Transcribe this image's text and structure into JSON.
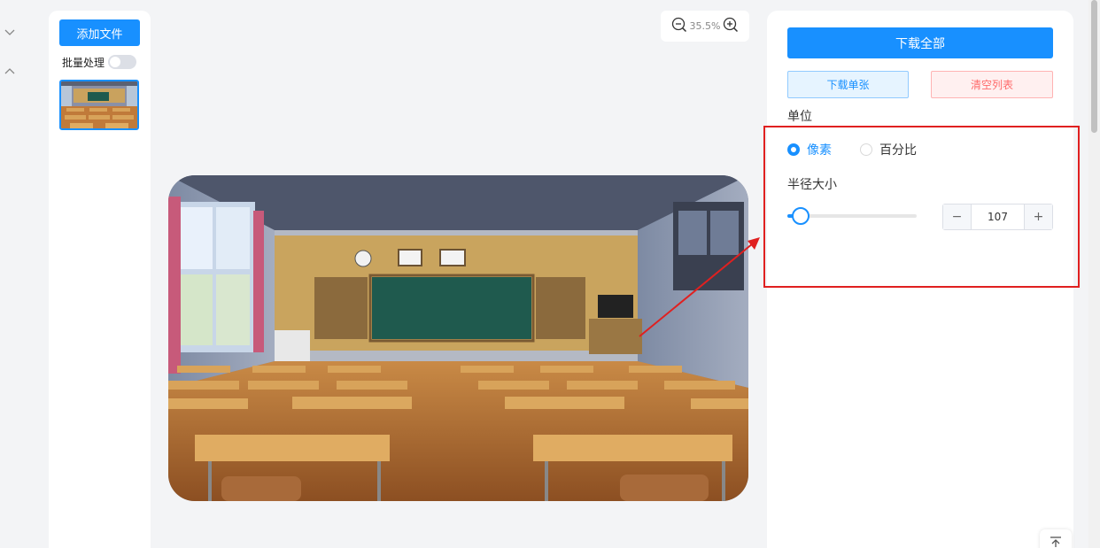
{
  "left": {
    "add_file_label": "添加文件",
    "batch_label": "批量处理",
    "batch_enabled": false
  },
  "zoom": {
    "level": "35.5%"
  },
  "right": {
    "download_all_label": "下载全部",
    "download_single_label": "下载单张",
    "clear_list_label": "清空列表",
    "unit_label": "单位",
    "unit_options": [
      "像素",
      "百分比"
    ],
    "unit_selected": "像素",
    "radius_label": "半径大小",
    "radius_value": "107",
    "slider_fraction": 0.1
  },
  "colors": {
    "primary": "#1890ff",
    "danger": "#ff6b6b",
    "highlight": "#e02020"
  },
  "icons": [
    "chevron-down-icon",
    "chevron-up-icon",
    "zoom-out-icon",
    "zoom-in-icon",
    "back-to-top-icon"
  ]
}
